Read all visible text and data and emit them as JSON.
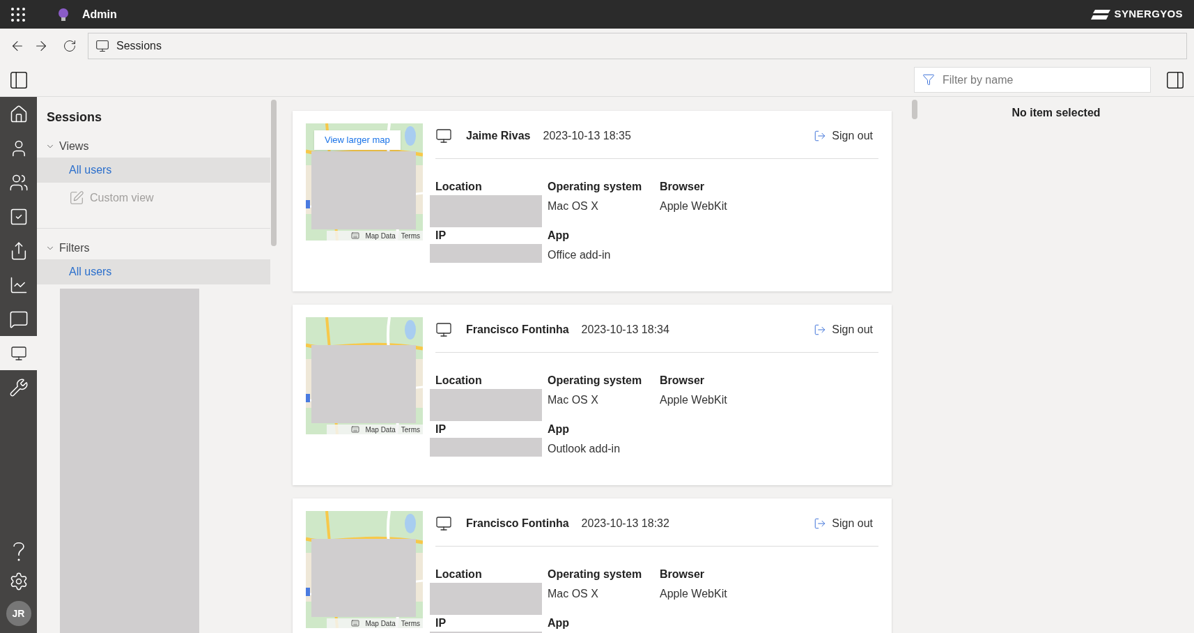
{
  "top_bar": {
    "app_name": "Admin",
    "brand": "SYNERGYOS"
  },
  "address_bar": {
    "title": "Sessions"
  },
  "filter": {
    "placeholder": "Filter by name"
  },
  "rail": [
    {
      "kind": "home",
      "selected": false
    },
    {
      "kind": "user",
      "selected": false
    },
    {
      "kind": "users",
      "selected": false
    },
    {
      "kind": "tasks",
      "selected": false
    },
    {
      "kind": "share",
      "selected": false
    },
    {
      "kind": "chart",
      "selected": false
    },
    {
      "kind": "chat",
      "selected": false
    },
    {
      "kind": "sessions",
      "selected": true
    },
    {
      "kind": "tools",
      "selected": false
    }
  ],
  "rail_bottom": {
    "avatar": "JR"
  },
  "sidebar": {
    "title": "Sessions",
    "sections": [
      {
        "label": "Views",
        "expanded": true,
        "items": [
          {
            "label": "All users",
            "selected": true,
            "disabled": false,
            "kind": "plain"
          },
          {
            "label": "Custom view",
            "selected": false,
            "disabled": true,
            "kind": "edit"
          }
        ]
      },
      {
        "label": "Filters",
        "expanded": true,
        "items": [
          {
            "label": "All users",
            "selected": true,
            "disabled": false,
            "kind": "plain"
          }
        ]
      }
    ]
  },
  "sessions": [
    {
      "name": "Jaime Rivas",
      "time": "2023-10-13 18:35",
      "action": "Sign out",
      "map": {
        "link": "View larger map",
        "data": "Map Data",
        "terms": "Terms"
      },
      "fields": [
        {
          "label": "Location",
          "kind": "redacted"
        },
        {
          "label": "Operating system",
          "kind": "text",
          "value": "Mac OS X"
        },
        {
          "label": "Browser",
          "kind": "text",
          "value": "Apple WebKit"
        },
        {
          "label": "IP",
          "kind": "redacted"
        },
        {
          "label": "App",
          "kind": "text",
          "value": "Office add-in"
        }
      ]
    },
    {
      "name": "Francisco Fontinha",
      "time": "2023-10-13 18:34",
      "action": "Sign out",
      "map": {
        "data": "Map Data",
        "terms": "Terms"
      },
      "fields": [
        {
          "label": "Location",
          "kind": "redacted"
        },
        {
          "label": "Operating system",
          "kind": "text",
          "value": "Mac OS X"
        },
        {
          "label": "Browser",
          "kind": "text",
          "value": "Apple WebKit"
        },
        {
          "label": "IP",
          "kind": "redacted"
        },
        {
          "label": "App",
          "kind": "text",
          "value": "Outlook add-in"
        }
      ]
    },
    {
      "name": "Francisco Fontinha",
      "time": "2023-10-13 18:32",
      "action": "Sign out",
      "map": {
        "data": "Map Data",
        "terms": "Terms"
      },
      "fields": [
        {
          "label": "Location",
          "kind": "redacted"
        },
        {
          "label": "Operating system",
          "kind": "text",
          "value": "Mac OS X"
        },
        {
          "label": "Browser",
          "kind": "text",
          "value": "Apple WebKit"
        },
        {
          "label": "IP",
          "kind": "redacted"
        },
        {
          "label": "App",
          "kind": "text"
        }
      ]
    }
  ],
  "details": {
    "empty_text": "No item selected"
  }
}
